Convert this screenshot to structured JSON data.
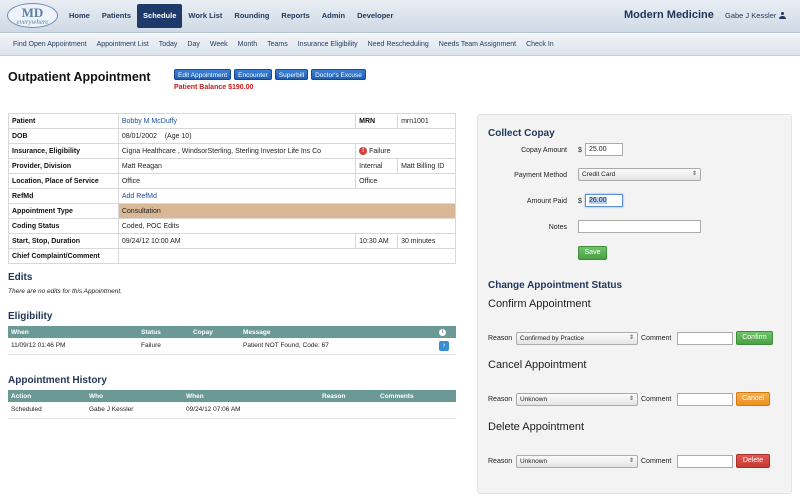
{
  "logo": {
    "md": "MD",
    "sub": "everywhere"
  },
  "main_nav": [
    {
      "label": "Home",
      "name": "nav-home"
    },
    {
      "label": "Patients",
      "name": "nav-patients"
    },
    {
      "label": "Schedule",
      "name": "nav-schedule",
      "active": true
    },
    {
      "label": "Work List",
      "name": "nav-work-list"
    },
    {
      "label": "Rounding",
      "name": "nav-rounding"
    },
    {
      "label": "Reports",
      "name": "nav-reports"
    },
    {
      "label": "Admin",
      "name": "nav-admin"
    },
    {
      "label": "Developer",
      "name": "nav-developer"
    }
  ],
  "brand": "Modern Medicine",
  "user": {
    "name": "Gabe J Kessler",
    "icon": "user-icon"
  },
  "sub_nav": [
    "Find Open Appointment",
    "Appointment List",
    "Today",
    "Day",
    "Week",
    "Month",
    "Teams",
    "Insurance Eligibility",
    "Need Rescheduling",
    "Needs Team Assignment",
    "Check In"
  ],
  "page_title": "Outpatient Appointment",
  "action_buttons": {
    "edit": "Edit Appointment",
    "encounter": "Encounter",
    "superbill": "Superbill",
    "excuse": "Doctor's Excuse"
  },
  "patient_balance": "Patient Balance $190.00",
  "info": {
    "patient_label": "Patient",
    "patient_value": "Bobby M McDuffy",
    "mrn_label": "MRN",
    "mrn_value": "mrn1001",
    "dob_label": "DOB",
    "dob_value": "08/01/2002",
    "age": "(Age 10)",
    "ins_label": "Insurance, Eligibility",
    "ins_value": "Cigna Healthcare , WindsorSterling, Sterling Investor Life Ins Co",
    "ins_status": "Failure",
    "provider_label": "Provider, Division",
    "provider_value": "Matt Reagan",
    "division_type": "Internal",
    "division_value": "Matt Billing ID",
    "location_label": "Location, Place of Service",
    "location_value": "Office",
    "pos_value": "Office",
    "refmd_label": "RefMd",
    "refmd_value": "Add RefMd",
    "appt_type_label": "Appointment Type",
    "appt_type_value": "Consultation",
    "coding_label": "Coding Status",
    "coding_value": "Coded, POC Edits",
    "time_label": "Start, Stop, Duration",
    "start": "09/24/12 10:00 AM",
    "stop": "10:30 AM",
    "duration": "30 minutes",
    "complaint_label": "Chief Complaint/Comment",
    "complaint_value": ""
  },
  "edits": {
    "title": "Edits",
    "note": "There are no edits for this Appointment."
  },
  "eligibility": {
    "title": "Eligibility",
    "headers": [
      "When",
      "Status",
      "Copay",
      "Message"
    ],
    "rows": [
      {
        "when": "11/09/12 01:46 PM",
        "status": "Failure",
        "copay": "",
        "message": "Patient NOT Found, Code: 67"
      }
    ]
  },
  "history": {
    "title": "Appointment History",
    "headers": [
      "Action",
      "Who",
      "When",
      "Reason",
      "Comments"
    ],
    "rows": [
      {
        "action": "Scheduled",
        "who": "Gabe J Kessler",
        "when": "09/24/12 07:06 AM",
        "reason": "",
        "comments": ""
      }
    ]
  },
  "copay": {
    "title": "Collect Copay",
    "amount_label": "Copay Amount",
    "amount_value": "25.00",
    "method_label": "Payment Method",
    "method_value": "Credit Card",
    "paid_label": "Amount Paid",
    "paid_value": "26.00",
    "notes_label": "Notes",
    "notes_value": "",
    "save": "Save",
    "currency": "$"
  },
  "status": {
    "title": "Change Appointment Status",
    "confirm": {
      "title": "Confirm Appointment",
      "reason_label": "Reason",
      "reason_value": "Confirmed by Practice",
      "comment_label": "Comment",
      "button": "Confirm"
    },
    "cancel": {
      "title": "Cancel Appointment",
      "reason_label": "Reason",
      "reason_value": "Unknown",
      "comment_label": "Comment",
      "button": "Cancel"
    },
    "delete": {
      "title": "Delete Appointment",
      "reason_label": "Reason",
      "reason_value": "Unknown",
      "comment_label": "Comment",
      "button": "Delete"
    }
  },
  "colors": {
    "nav_active": "#1e3a6a",
    "table_header": "#6b9a96",
    "highlight_row": "#d8b896",
    "balance": "#c41a1a"
  }
}
